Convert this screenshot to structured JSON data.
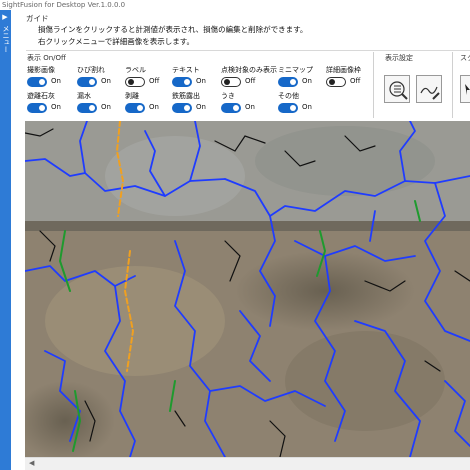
{
  "app": {
    "title": "SightFusion for Desktop Ver.1.0.0.0"
  },
  "sidebar": {
    "arrow": "▶",
    "label": "メニュー"
  },
  "guide": {
    "title": "ガイド",
    "lines": [
      "損傷ラインをクリックすると計測値が表示され、損傷の編集と削除ができます。",
      "右クリックメニューで詳細画像を表示します。"
    ]
  },
  "display_toggles": {
    "section_label": "表示 On/Off",
    "on_text": "On",
    "off_text": "Off",
    "items": [
      {
        "label": "撮影画像",
        "on": true
      },
      {
        "label": "ひび割れ",
        "on": true
      },
      {
        "label": "ラベル",
        "on": false
      },
      {
        "label": "テキスト",
        "on": true
      },
      {
        "label": "点検対象のみ表示",
        "on": false
      },
      {
        "label": "ミニマップ",
        "on": true
      },
      {
        "label": "詳細画像枠",
        "on": false
      },
      {
        "label": "遊離石灰",
        "on": true
      },
      {
        "label": "漏水",
        "on": true
      },
      {
        "label": "剥離",
        "on": true
      },
      {
        "label": "鉄筋露出",
        "on": true
      },
      {
        "label": "うき",
        "on": true
      },
      {
        "label": "その他",
        "on": true
      }
    ]
  },
  "display_settings": {
    "section_label": "表示設定",
    "buttons": [
      "settings-list-icon",
      "line-style-icon"
    ]
  },
  "scroll_section": {
    "section_label": "スク"
  },
  "viewer": {
    "crack_colors": {
      "blue": "#1f3cff",
      "black": "#111111",
      "green": "#1e9a2e",
      "orange": "#f0a020"
    }
  },
  "scrollbar": {
    "left_arrow": "◀"
  }
}
